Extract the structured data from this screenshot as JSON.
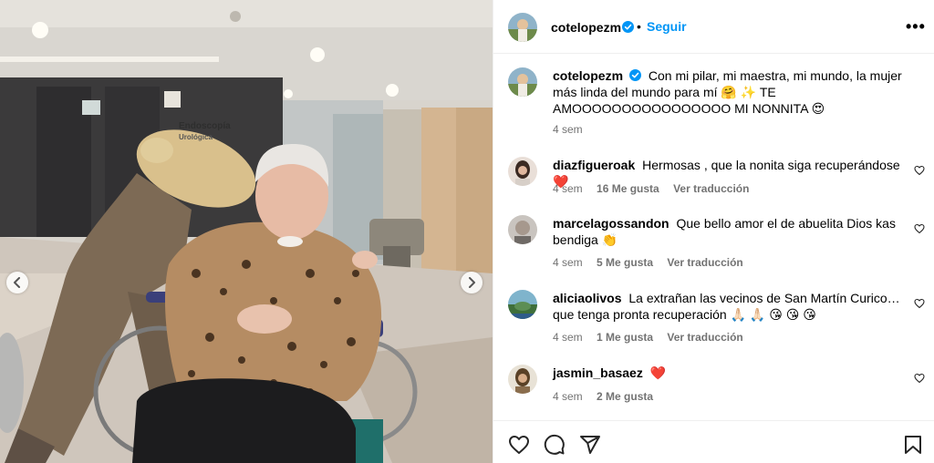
{
  "post": {
    "photo_sign": [
      "Endoscopía",
      "Urológica"
    ]
  },
  "header": {
    "username": "cotelopezm",
    "separator": "•",
    "follow_label": "Seguir",
    "more_label": "•••"
  },
  "caption": {
    "username": "cotelopezm",
    "text": "Con mi pilar, mi maestra, mi mundo, la mujer más linda del mundo para mí 🤗 ✨ TE AMOOOOOOOOOOOOOOOO MI NONNITA 😍",
    "time": "4 sem"
  },
  "comments": [
    {
      "username": "diazfigueroak",
      "text": "Hermosas , que la nonita siga recuperándose ❤️",
      "time": "4 sem",
      "likes": "16 Me gusta",
      "translate": "Ver traducción"
    },
    {
      "username": "marcelagossandon",
      "text": "Que bello amor el de abuelita Dios kas bendiga 👏",
      "time": "4 sem",
      "likes": "5 Me gusta",
      "translate": "Ver traducción"
    },
    {
      "username": "aliciaolivos",
      "text": "La extrañan las vecinos de San Martín Curico…que tenga pronta recuperación 🙏🏻 🙏🏻 😘 😘 😘",
      "time": "4 sem",
      "likes": "1 Me gusta",
      "translate": "Ver traducción"
    },
    {
      "username": "jasmin_basaez",
      "text": "❤️",
      "time": "4 sem",
      "likes": "2 Me gusta",
      "translate": ""
    }
  ],
  "icons": {
    "like": "heart-icon",
    "comment": "comment-icon",
    "share": "share-icon",
    "save": "bookmark-icon",
    "verified": "verified-badge-icon"
  },
  "colors": {
    "accent": "#0095f6",
    "verified": "#0095f6",
    "muted": "#737373",
    "divider": "#efefef"
  }
}
